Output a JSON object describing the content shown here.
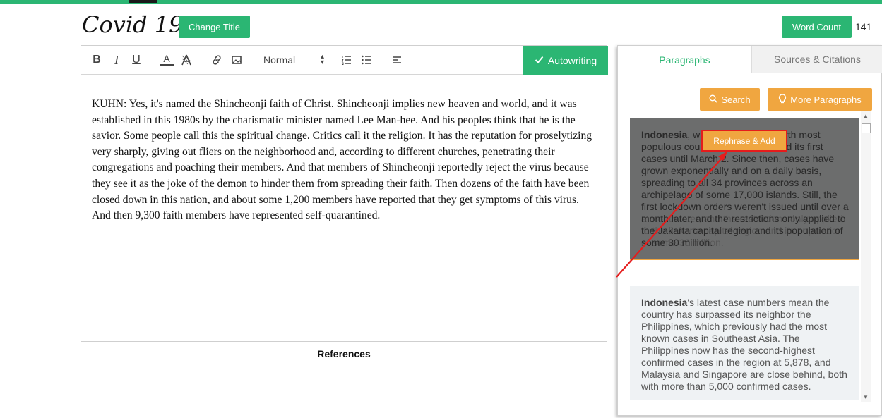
{
  "header": {
    "doc_title": "Covid 19",
    "change_title_label": "Change Title",
    "word_count_label": "Word Count",
    "word_count_value": "141"
  },
  "toolbar": {
    "bold": "B",
    "italic": "I",
    "underline": "U",
    "text_color": "A",
    "size_value": "Normal",
    "autowriting_label": "Autowriting",
    "icons": [
      "bold-icon",
      "italic-icon",
      "underline-icon",
      "text-color-icon",
      "background-color-icon",
      "link-icon",
      "image-icon",
      "ordered-list-icon",
      "bullet-list-icon",
      "align-icon",
      "check-icon"
    ]
  },
  "editor": {
    "body_text": "KUHN: Yes, it's named the Shincheonji faith of Christ. Shincheonji implies new heaven and world, and it was established in this 1980s by the charismatic minister named Lee Man-hee. And his peoples think that he is the savior. Some people call this the spiritual change. Critics call it the religion. It has the reputation for proselytizing very sharply, giving out fliers on the neighborhood and, according to different churches, penetrating their congregations and poaching their members. And that members of Shincheonji reportedly reject the virus because they see it as the joke of the demon to hinder them from spreading their faith. Then dozens of the faith have been closed down in this nation, and about some 1,200 members have reported that they get symptoms of this virus. And then 9,300 faith members have represented self-quarantined.",
    "references_title": "References"
  },
  "panel": {
    "tabs": [
      {
        "label": "Paragraphs",
        "active": true
      },
      {
        "label": "Sources & Citations",
        "active": false
      }
    ],
    "search_label": "Search",
    "more_paragraphs_label": "More Paragraphs",
    "rephrase_label": "Rephrase & Add",
    "cards": [
      {
        "bold": "Indonesia",
        "text": ", which reports the fourth most populous country in the world, had its first cases until March 2. Since then, cases have grown exponentially and on a daily basis, spreading to all 34 provinces across an archipelago of some 17,000 islands. Still, the first lockdown orders weren't issued until over a month later, and the restrictions only applied to the Jakarta capital region and its population of some 30 million."
      },
      {
        "bold": "Indonesia",
        "text": "'s latest case numbers mean the country has surpassed its neighbor the Philippines, which previously had the most known cases in Southeast Asia. The Philippines now has the second-highest confirmed cases in the region at 5,878, and Malaysia and Singapore are close behind, both with more than 5,000 confirmed cases."
      }
    ]
  },
  "colors": {
    "accent_green": "#2bb673",
    "accent_orange": "#f0a640",
    "highlight_red": "#e51c1c"
  }
}
